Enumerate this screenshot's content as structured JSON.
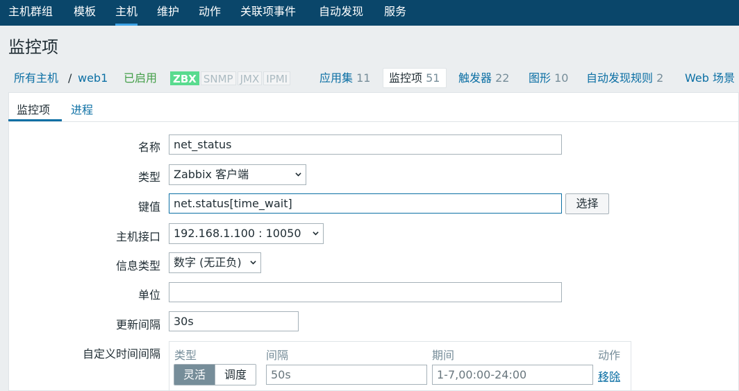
{
  "nav": {
    "items": [
      {
        "label": "主机群组"
      },
      {
        "label": "模板"
      },
      {
        "label": "主机"
      },
      {
        "label": "维护"
      },
      {
        "label": "动作"
      },
      {
        "label": "关联项事件"
      },
      {
        "label": "自动发现"
      },
      {
        "label": "服务"
      }
    ],
    "active": "主机"
  },
  "page_title": "监控项",
  "hostbar": {
    "all_hosts": "所有主机",
    "separator": "/",
    "host": "web1",
    "status": "已启用",
    "availability": [
      "ZBX",
      "SNMP",
      "JMX",
      "IPMI"
    ],
    "tabs": [
      {
        "label": "应用集",
        "count": "11"
      },
      {
        "label": "监控项",
        "count": "51"
      },
      {
        "label": "触发器",
        "count": "22"
      },
      {
        "label": "图形",
        "count": "10"
      },
      {
        "label": "自动发现规则",
        "count": "2"
      },
      {
        "label": "Web 场景",
        "count": ""
      }
    ]
  },
  "subtabs": [
    "监控项",
    "进程"
  ],
  "form": {
    "name_label": "名称",
    "name_value": "net_status",
    "type_label": "类型",
    "type_value": "Zabbix 客户端",
    "key_label": "键值",
    "key_value": "net.status[time_wait]",
    "select_button": "选择",
    "interface_label": "主机接口",
    "interface_value": "192.168.1.100 : 10050",
    "info_type_label": "信息类型",
    "info_type_value": "数字 (无正负)",
    "units_label": "单位",
    "units_value": "",
    "update_label": "更新间隔",
    "update_value": "30s",
    "custom_label": "自定义时间间隔",
    "custom": {
      "col_type": "类型",
      "col_interval": "间隔",
      "col_period": "期间",
      "col_action": "动作",
      "type_flexible": "灵活",
      "type_scheduling": "调度",
      "interval_value": "50s",
      "period_value": "1-7,00:00-24:00",
      "remove": "移除"
    }
  },
  "colors": {
    "nav_bg": "#0a466a",
    "link": "#0b6fa4",
    "enabled": "#429e47",
    "zbx_on": "#59db8f"
  }
}
